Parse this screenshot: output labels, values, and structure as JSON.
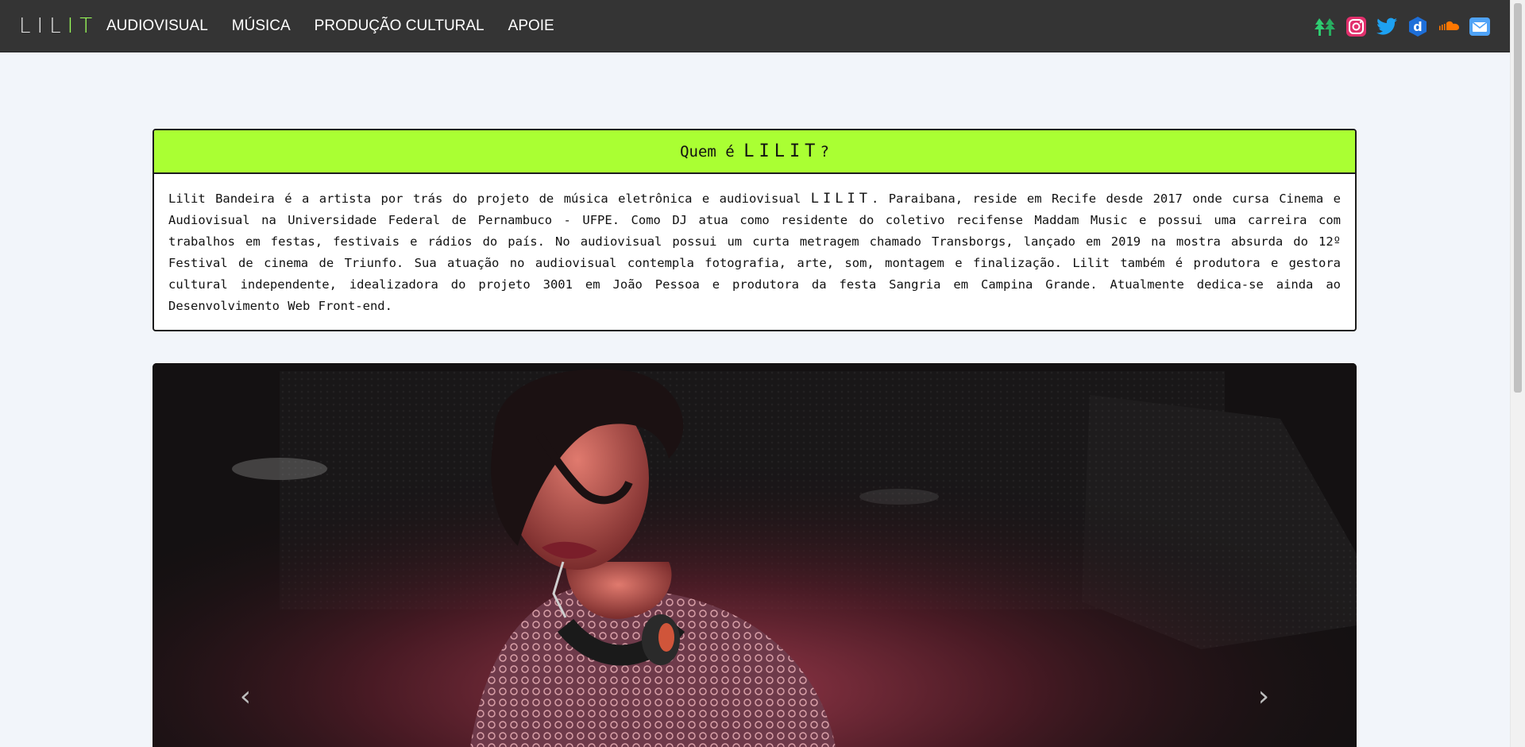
{
  "navbar": {
    "brand": {
      "main": "LIL",
      "accent": "IT"
    },
    "links": [
      "AUDIOVISUAL",
      "MÚSICA",
      "PRODUÇÃO CULTURAL",
      "APOIE"
    ],
    "social_icons": [
      "linktree-icon",
      "instagram-icon",
      "twitter-icon",
      "deezer-icon",
      "soundcloud-icon",
      "email-icon"
    ]
  },
  "about": {
    "header_prefix": "Quem é",
    "header_name": "LILIT",
    "header_suffix": "?",
    "text_before_name": "Lilit Bandeira é a artista por trás do projeto de música eletrônica e audiovisual ",
    "text_name": "LILIT",
    "text_after_name": ". Paraibana, reside em Recife desde 2017 onde cursa Cinema e Audiovisual na Universidade Federal de Pernambuco - UFPE. Como DJ atua como residente do coletivo recifense Maddam Music e possui uma carreira com trabalhos em festas, festivais e rádios do país. No audiovisual possui um curta metragem chamado Transborgs, lançado em 2019 na mostra absurda do 12º Festival de cinema de Triunfo. Sua atuação no audiovisual contempla fotografia, arte, som, montagem e finalização. Lilit também é produtora e gestora cultural independente, idealizadora do projeto 3001 em João Pessoa e produtora da festa Sangria em Campina Grande. Atualmente dedica-se ainda ao Desenvolvimento Web Front-end."
  },
  "carousel": {
    "prev_symbol": "‹",
    "next_symbol": "›"
  },
  "colors": {
    "navbar_bg": "#343434",
    "accent_green": "#aaff33",
    "page_bg": "#f2f5fa"
  }
}
